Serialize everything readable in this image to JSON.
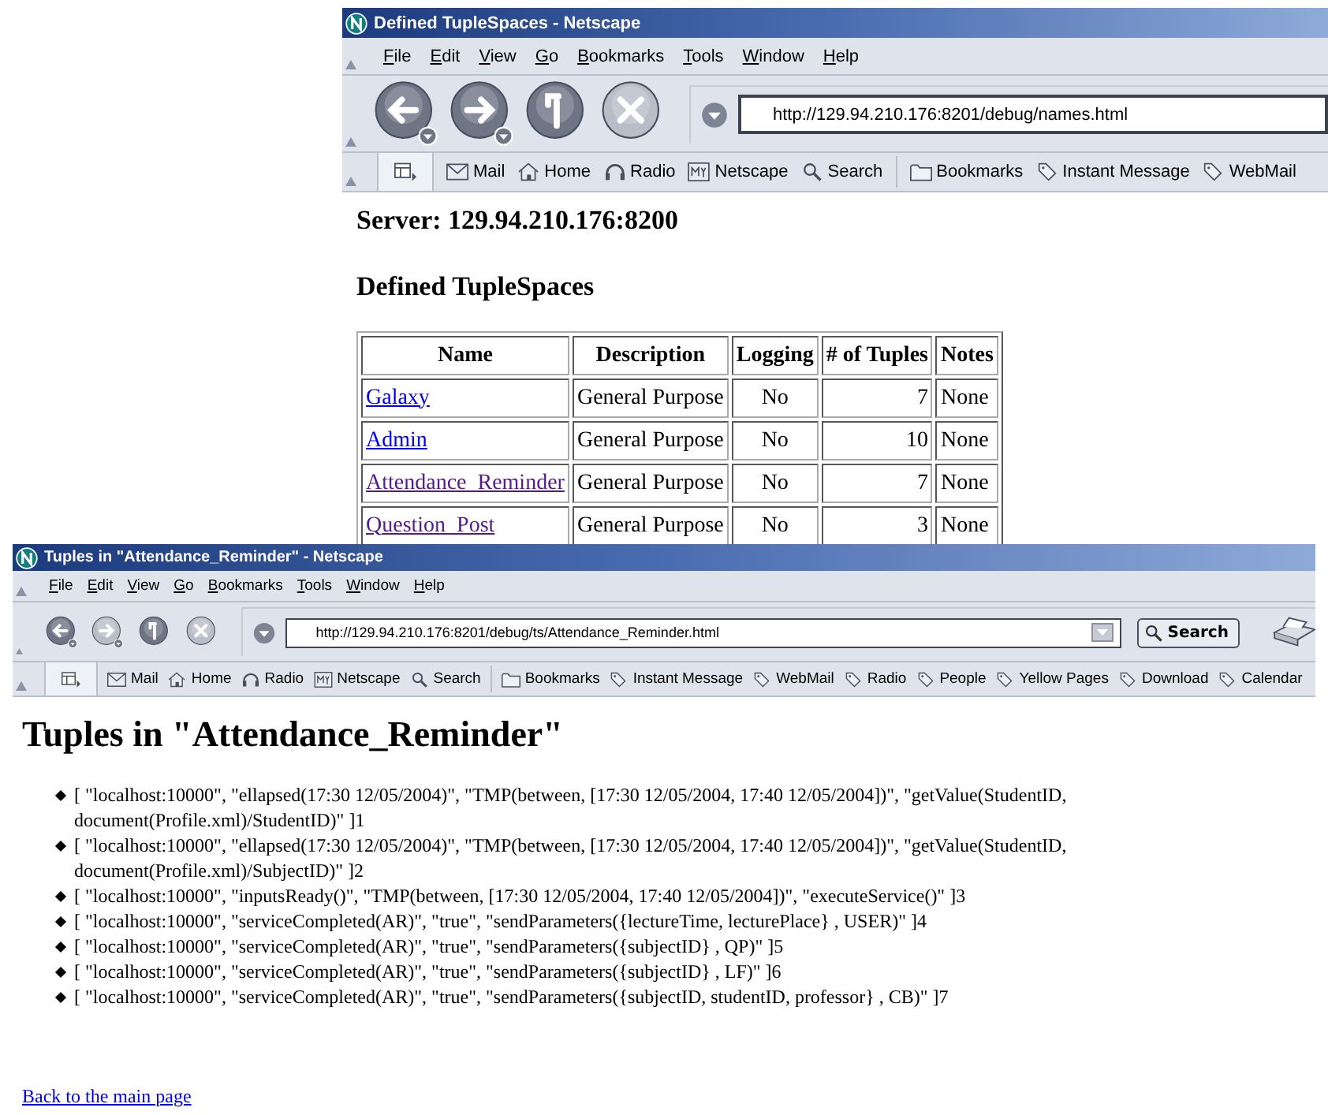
{
  "windows": [
    {
      "title": "Defined TupleSpaces - Netscape",
      "menu": [
        "File",
        "Edit",
        "View",
        "Go",
        "Bookmarks",
        "Tools",
        "Window",
        "Help"
      ],
      "nav_buttons": [
        {
          "kind": "back",
          "disabled": false
        },
        {
          "kind": "forward",
          "disabled": false
        },
        {
          "kind": "reload",
          "disabled": false
        },
        {
          "kind": "stop",
          "disabled": true
        }
      ],
      "url": "http://129.94.210.176:8201/debug/names.html",
      "personal_toolbar": [
        {
          "kind": "mail",
          "label": "Mail"
        },
        {
          "kind": "home",
          "label": "Home"
        },
        {
          "kind": "radio",
          "label": "Radio"
        },
        {
          "kind": "my",
          "label": "Netscape"
        },
        {
          "kind": "search",
          "label": "Search"
        },
        {
          "kind": "folder",
          "label": "Bookmarks"
        },
        {
          "kind": "link",
          "label": "Instant Message"
        },
        {
          "kind": "link",
          "label": "WebMail"
        }
      ],
      "page": {
        "kind": "tuplespaces",
        "server": "Server: 129.94.210.176:8200",
        "heading": "Defined TupleSpaces",
        "table": {
          "columns": [
            "Name",
            "Description",
            "Logging",
            "# of Tuples",
            "Notes"
          ],
          "rows": [
            {
              "name": "Galaxy",
              "visited": false,
              "description": "General Purpose",
              "logging": "No",
              "tuples": "7",
              "notes": "None"
            },
            {
              "name": "Admin",
              "visited": false,
              "description": "General Purpose",
              "logging": "No",
              "tuples": "10",
              "notes": "None"
            },
            {
              "name": "Attendance_Reminder",
              "visited": true,
              "description": "General Purpose",
              "logging": "No",
              "tuples": "7",
              "notes": "None"
            },
            {
              "name": "Question_Post",
              "visited": true,
              "description": "General Purpose",
              "logging": "No",
              "tuples": "3",
              "notes": "None"
            }
          ]
        }
      }
    },
    {
      "title": "Tuples in \"Attendance_Reminder\" - Netscape",
      "menu": [
        "File",
        "Edit",
        "View",
        "Go",
        "Bookmarks",
        "Tools",
        "Window",
        "Help"
      ],
      "nav_buttons": [
        {
          "kind": "back",
          "disabled": false
        },
        {
          "kind": "forward",
          "disabled": true
        },
        {
          "kind": "reload",
          "disabled": false
        },
        {
          "kind": "stop",
          "disabled": true
        }
      ],
      "url": "http://129.94.210.176:8201/debug/ts/Attendance_Reminder.html",
      "search_button": "Search",
      "personal_toolbar": [
        {
          "kind": "mail",
          "label": "Mail"
        },
        {
          "kind": "home",
          "label": "Home"
        },
        {
          "kind": "radio",
          "label": "Radio"
        },
        {
          "kind": "my",
          "label": "Netscape"
        },
        {
          "kind": "search",
          "label": "Search"
        },
        {
          "kind": "folder",
          "label": "Bookmarks"
        },
        {
          "kind": "link",
          "label": "Instant Message"
        },
        {
          "kind": "link",
          "label": "WebMail"
        },
        {
          "kind": "link",
          "label": "Radio"
        },
        {
          "kind": "link",
          "label": "People"
        },
        {
          "kind": "link",
          "label": "Yellow Pages"
        },
        {
          "kind": "link",
          "label": "Download"
        },
        {
          "kind": "link",
          "label": "Calendar"
        }
      ],
      "page": {
        "kind": "tuples",
        "heading": "Tuples in \"Attendance_Reminder\"",
        "tuples": [
          "[ \"localhost:10000\", \"ellapsed(17:30 12/05/2004)\", \"TMP(between, [17:30 12/05/2004, 17:40 12/05/2004])\", \"getValue(StudentID, document(Profile.xml)/StudentID)\" ]1",
          "[ \"localhost:10000\", \"ellapsed(17:30 12/05/2004)\", \"TMP(between, [17:30 12/05/2004, 17:40 12/05/2004])\", \"getValue(StudentID, document(Profile.xml)/SubjectID)\" ]2",
          "[ \"localhost:10000\", \"inputsReady()\", \"TMP(between, [17:30 12/05/2004, 17:40 12/05/2004])\", \"executeService()\" ]3",
          "[ \"localhost:10000\", \"serviceCompleted(AR)\", \"true\", \"sendParameters({lectureTime, lecturePlace} , USER)\" ]4",
          "[ \"localhost:10000\", \"serviceCompleted(AR)\", \"true\", \"sendParameters({subjectID} , QP)\" ]5",
          "[ \"localhost:10000\", \"serviceCompleted(AR)\", \"true\", \"sendParameters({subjectID} , LF)\" ]6",
          "[ \"localhost:10000\", \"serviceCompleted(AR)\", \"true\", \"sendParameters({subjectID, studentID, professor} , CB)\" ]7"
        ],
        "back_link": "Back to the main page"
      }
    }
  ]
}
